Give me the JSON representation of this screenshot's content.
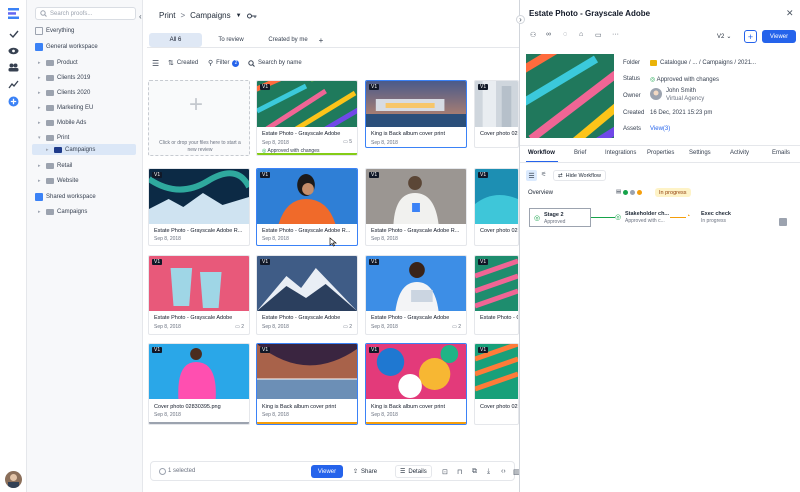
{
  "sidebar": {
    "search_placeholder": "Search proofs...",
    "items": [
      {
        "label": "Everything"
      },
      {
        "label": "General workspace"
      },
      {
        "label": "Product"
      },
      {
        "label": "Clients 2019"
      },
      {
        "label": "Clients 2020"
      },
      {
        "label": "Marketing EU"
      },
      {
        "label": "Mobile Ads"
      },
      {
        "label": "Print"
      },
      {
        "label": "Campaigns"
      },
      {
        "label": "Retail"
      },
      {
        "label": "Website"
      },
      {
        "label": "Shared workspace"
      },
      {
        "label": "Campaigns"
      }
    ]
  },
  "header": {
    "crumb_parent": "Print",
    "crumb_sep": ">",
    "crumb_current": "Campaigns"
  },
  "tabs": [
    {
      "label": "All",
      "count": "6"
    },
    {
      "label": "To review"
    },
    {
      "label": "Created by me"
    },
    {
      "label": "+"
    }
  ],
  "toolbar": {
    "sort_label": "Created",
    "filter_label": "Filter",
    "filter_count": "2",
    "search_placeholder": "Search by name"
  },
  "upload": {
    "text": "Click or drop your files here to start a new review"
  },
  "cards": [
    {
      "ver": "V1",
      "title": "Estate Photo - Grayscale Adobe",
      "date": "Sep 8, 2018",
      "status": "Approved with changes",
      "comments": "5"
    },
    {
      "ver": "V1",
      "title": "King is Back album cover print",
      "date": "Sep 8, 2018"
    },
    {
      "ver": "V1",
      "title": "Cover photo 023..."
    },
    {
      "ver": "V1",
      "title": "Estate Photo - Grayscale Adobe R...",
      "date": "Sep 8, 2018"
    },
    {
      "ver": "V1",
      "title": "Estate Photo - Grayscale Adobe R...",
      "date": "Sep 8, 2018"
    },
    {
      "ver": "V1",
      "title": "Estate Photo - Grayscale Adobe R...",
      "date": "Sep 8, 2018"
    },
    {
      "ver": "V1",
      "title": "Cover photo 023..."
    },
    {
      "ver": "V1",
      "title": "Estate Photo - Grayscale Adobe R...",
      "date": "Sep 8, 2018",
      "comments": "2"
    },
    {
      "ver": "V1",
      "title": "Estate Photo - Grayscale Adobe R...",
      "date": "Sep 8, 2018",
      "comments": "2"
    },
    {
      "ver": "V1",
      "title": "Estate Photo - Grayscale Adobe R...",
      "date": "Sep 8, 2018",
      "comments": "2"
    },
    {
      "ver": "V1",
      "title": "Estate Photo - Gr..."
    },
    {
      "ver": "V1",
      "title": "Cover photo 02830395.png",
      "date": "Sep 8, 2018"
    },
    {
      "ver": "V1",
      "title": "King is Back album cover print",
      "date": "Sep 8, 2018"
    },
    {
      "ver": "V1",
      "title": "King is Back album cover print",
      "date": "Sep 8, 2018"
    },
    {
      "ver": "V1",
      "title": "Cover photo 023..."
    }
  ],
  "bottom_bar": {
    "selected": "1 selected",
    "viewer": "Viewer",
    "share": "Share",
    "details": "Details"
  },
  "panel": {
    "title": "Estate Photo - Grayscale Adobe",
    "version": "V2",
    "viewer_btn": "Viewer",
    "folder_label": "Folder",
    "folder_value": "Catalogue / ... / Campaigns / 2021...",
    "status_label": "Status",
    "status_value": "Approved with changes",
    "owner_label": "Owner",
    "owner_name": "John Smith",
    "owner_agency": "Virtual Agency",
    "created_label": "Created",
    "created_value": "16 Dec, 2021 15:23 pm",
    "assets_label": "Assets",
    "assets_value": "View(3)",
    "tabs": [
      "Workflow",
      "Brief",
      "Integrations",
      "Properties",
      "Settings",
      "Activity",
      "Emails"
    ],
    "hide_workflow": "Hide Workflow",
    "overview": "Overview",
    "overview_badge": "In progress",
    "stages": [
      {
        "name": "Stage 2",
        "status": "Approved"
      },
      {
        "name": "Stakeholder ch...",
        "status": "Approved with c..."
      },
      {
        "name": "Exec check",
        "status": "In progress"
      }
    ]
  },
  "colors": {
    "accent": "#2563eb",
    "approved": "#16a34a",
    "progress": "#f59e0b"
  }
}
